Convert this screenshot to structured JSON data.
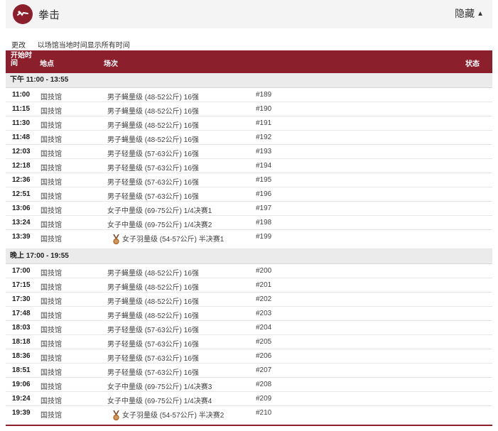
{
  "header": {
    "title": "拳击",
    "hide_label": "隐藏",
    "accent": "#8b1f2c"
  },
  "notice": {
    "change_label": "更改",
    "text": "以场馆当地时间显示所有时间"
  },
  "table_header": {
    "start": "开始时间",
    "venue": "地点",
    "event": "场次",
    "status": "状态"
  },
  "sessions": [
    {
      "label": "下午  11:00 - 13:55",
      "rows": [
        {
          "time": "11:00",
          "venue": "国技馆",
          "event": "男子蝇量级 (48-52公斤) 16强",
          "num": "#189"
        },
        {
          "time": "11:15",
          "venue": "国技馆",
          "event": "男子蝇量级 (48-52公斤) 16强",
          "num": "#190"
        },
        {
          "time": "11:30",
          "venue": "国技馆",
          "event": "男子蝇量级 (48-52公斤) 16强",
          "num": "#191"
        },
        {
          "time": "11:48",
          "venue": "国技馆",
          "event": "男子蝇量级 (48-52公斤) 16强",
          "num": "#192"
        },
        {
          "time": "12:03",
          "venue": "国技馆",
          "event": "男子轻量级 (57-63公斤) 16强",
          "num": "#193"
        },
        {
          "time": "12:18",
          "venue": "国技馆",
          "event": "男子轻量级 (57-63公斤) 16强",
          "num": "#194"
        },
        {
          "time": "12:36",
          "venue": "国技馆",
          "event": "男子轻量级 (57-63公斤) 16强",
          "num": "#195"
        },
        {
          "time": "12:51",
          "venue": "国技馆",
          "event": "男子轻量级 (57-63公斤) 16强",
          "num": "#196"
        },
        {
          "time": "13:06",
          "venue": "国技馆",
          "event": "女子中量级 (69-75公斤) 1/4决赛1",
          "num": "#197"
        },
        {
          "time": "13:24",
          "venue": "国技馆",
          "event": "女子中量级 (69-75公斤) 1/4决赛2",
          "num": "#198"
        },
        {
          "time": "13:39",
          "venue": "国技馆",
          "event": "女子羽量级 (54-57公斤) 半决赛1",
          "num": "#199",
          "medal": "bronze-medal-icon"
        }
      ]
    },
    {
      "label": "晚上  17:00 - 19:55",
      "rows": [
        {
          "time": "17:00",
          "venue": "国技馆",
          "event": "男子蝇量级 (48-52公斤) 16强",
          "num": "#200"
        },
        {
          "time": "17:15",
          "venue": "国技馆",
          "event": "男子蝇量级 (48-52公斤) 16强",
          "num": "#201"
        },
        {
          "time": "17:30",
          "venue": "国技馆",
          "event": "男子蝇量级 (48-52公斤) 16强",
          "num": "#202"
        },
        {
          "time": "17:48",
          "venue": "国技馆",
          "event": "男子蝇量级 (48-52公斤) 16强",
          "num": "#203"
        },
        {
          "time": "18:03",
          "venue": "国技馆",
          "event": "男子轻量级 (57-63公斤) 16强",
          "num": "#204"
        },
        {
          "time": "18:18",
          "venue": "国技馆",
          "event": "男子轻量级 (57-63公斤) 16强",
          "num": "#205"
        },
        {
          "time": "18:36",
          "venue": "国技馆",
          "event": "男子轻量级 (57-63公斤) 16强",
          "num": "#206"
        },
        {
          "time": "18:51",
          "venue": "国技馆",
          "event": "男子轻量级 (57-63公斤) 16强",
          "num": "#207"
        },
        {
          "time": "19:06",
          "venue": "国技馆",
          "event": "女子中量级 (69-75公斤) 1/4决赛3",
          "num": "#208"
        },
        {
          "time": "19:24",
          "venue": "国技馆",
          "event": "女子中量级 (69-75公斤) 1/4决赛4",
          "num": "#209"
        },
        {
          "time": "19:39",
          "venue": "国技馆",
          "event": "女子羽量级 (54-57公斤) 半决赛2",
          "num": "#210",
          "medal": "bronze-medal-icon"
        }
      ]
    }
  ]
}
